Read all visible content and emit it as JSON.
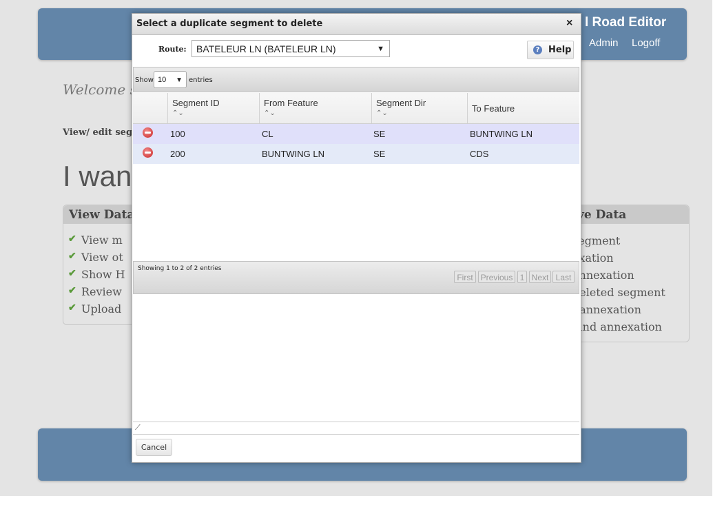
{
  "app": {
    "title_visible": "l Road Editor",
    "nav": [
      {
        "label": "Admin"
      },
      {
        "label": "Logoff"
      }
    ]
  },
  "background": {
    "welcome_text": "Welcome ste",
    "view_edit_text": "View/ edit segm",
    "heading_text": "I want",
    "left_panel": {
      "title": "View Data",
      "items": [
        "View m",
        "View ot",
        "Show H",
        "Review",
        "Upload"
      ]
    },
    "right_panel": {
      "title": "ve Data",
      "items": [
        "segment",
        "exation",
        "annexation",
        "deleted segment",
        "l annexation",
        "land annexation"
      ]
    }
  },
  "dialog": {
    "title": "Select a duplicate segment to delete",
    "close_glyph": "×",
    "route": {
      "label": "Route:",
      "selected": "BATELEUR LN (BATELEUR LN)",
      "arrow": "▼"
    },
    "help": {
      "icon_glyph": "?",
      "label": "Help"
    },
    "length_menu": {
      "show_label": "Show",
      "value": "10",
      "arrow": "▼",
      "entries_label": "entries"
    },
    "table": {
      "sort_glyph": "⌃⌄",
      "columns": [
        "",
        "Segment ID",
        "From Feature",
        "Segment Dir",
        "To Feature"
      ],
      "rows": [
        {
          "segment_id": "100",
          "from_feature": "CL",
          "segment_dir": "SE",
          "to_feature": "BUNTWING LN"
        },
        {
          "segment_id": "200",
          "from_feature": "BUNTWING LN",
          "segment_dir": "SE",
          "to_feature": "CDS"
        }
      ]
    },
    "info": "Showing 1 to 2 of 2 entries",
    "pagination": [
      "First",
      "Previous",
      "1",
      "Next",
      "Last"
    ],
    "resize_glyph": "⟋",
    "cancel_label": "Cancel"
  },
  "colors": {
    "header_blue": "#6285a8",
    "row_odd": "#e0e0fa",
    "row_even": "#e4eaf8",
    "check_green": "#5a9a3a",
    "delete_red": "#cc2b2b"
  }
}
